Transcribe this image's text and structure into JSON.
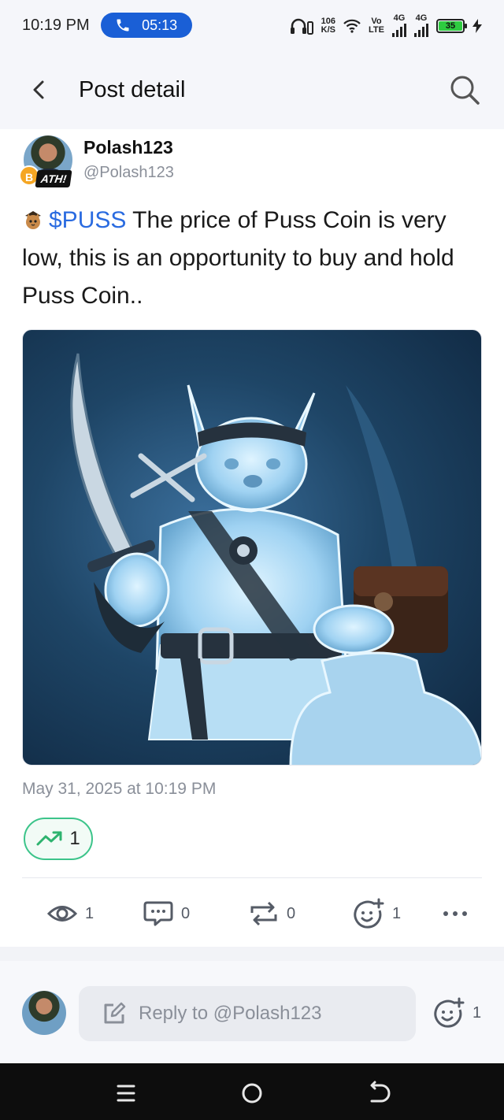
{
  "status_bar": {
    "time": "10:19 PM",
    "call_timer": "05:13",
    "net_speed_top": "106",
    "net_speed_bottom": "K/S",
    "volte_top": "Vo",
    "volte_bottom": "LTE",
    "sim1_label": "4G",
    "sim2_label": "4G",
    "battery": "35"
  },
  "header": {
    "title": "Post detail"
  },
  "post": {
    "author_name": "Polash123",
    "author_handle": "@Polash123",
    "badge_text": "ATH!",
    "coin_badge": "B",
    "ticker": "$PUSS",
    "body": " The price of Puss Coin is very low, this is an opportunity to buy and hold Puss Coin..",
    "timestamp": "May 31, 2025 at 10:19 PM",
    "trend_count": "1"
  },
  "actions": {
    "views": "1",
    "comments": "0",
    "reposts": "0",
    "reactions": "1"
  },
  "reply": {
    "placeholder": "Reply to @Polash123",
    "reaction_count": "1"
  },
  "colors": {
    "accent_blue": "#2a6be0",
    "call_pill": "#1a5fd6",
    "trend_green": "#3cc48a",
    "muted_text": "#8a8f99"
  }
}
